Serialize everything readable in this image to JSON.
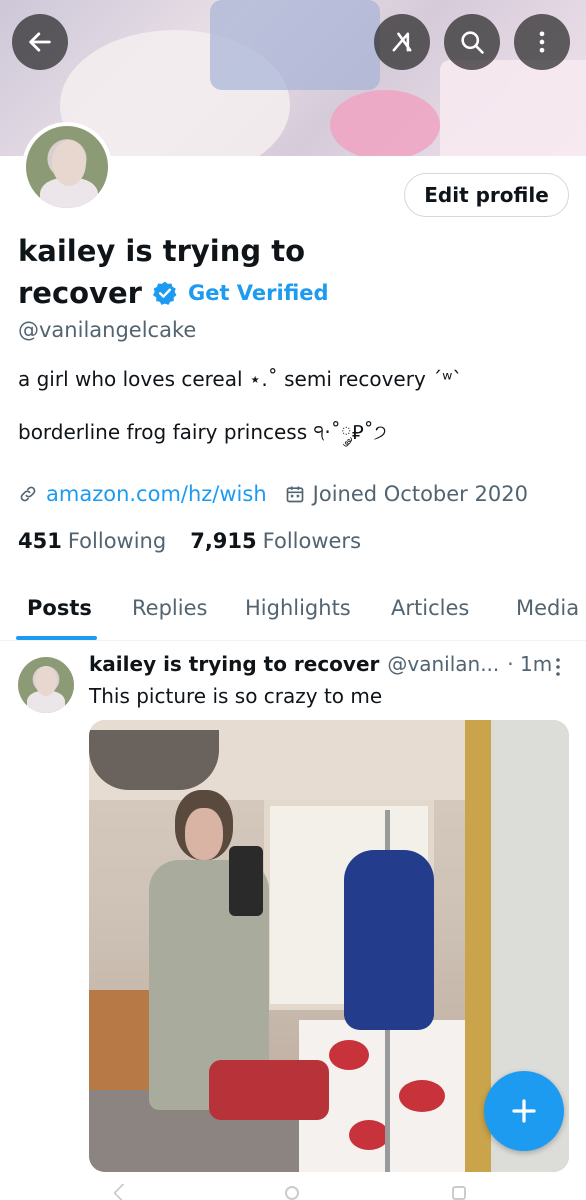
{
  "header": {
    "back_icon": "back-arrow-icon",
    "grok_icon": "grok-icon",
    "search_icon": "search-icon",
    "more_icon": "more-vertical-icon"
  },
  "profile": {
    "name_line1": "kailey is trying to",
    "name_line2": "recover",
    "get_verified": "Get Verified",
    "handle": "@vanilangelcake",
    "bio_line1": "a girl who loves cereal ⋆.˚ semi recovery ´ʷˋ",
    "bio_line2": "borderline frog fairy princess ੧·˚༘⃊˚੭",
    "link": "amazon.com/hz/wish",
    "joined": "Joined October 2020",
    "following_count": "451",
    "following_label": "Following",
    "followers_count": "7,915",
    "followers_label": "Followers",
    "edit_profile": "Edit profile"
  },
  "tabs": [
    {
      "label": "Posts",
      "active": true
    },
    {
      "label": "Replies",
      "active": false
    },
    {
      "label": "Highlights",
      "active": false
    },
    {
      "label": "Articles",
      "active": false
    },
    {
      "label": "Media",
      "active": false
    }
  ],
  "post": {
    "name": "kailey is trying to recover",
    "handle": "@vanilan...",
    "time": "· 1m",
    "text": "This picture is so crazy to me"
  },
  "colors": {
    "accent": "#1d9bf0",
    "text_primary": "#0f1419",
    "text_secondary": "#536471"
  }
}
